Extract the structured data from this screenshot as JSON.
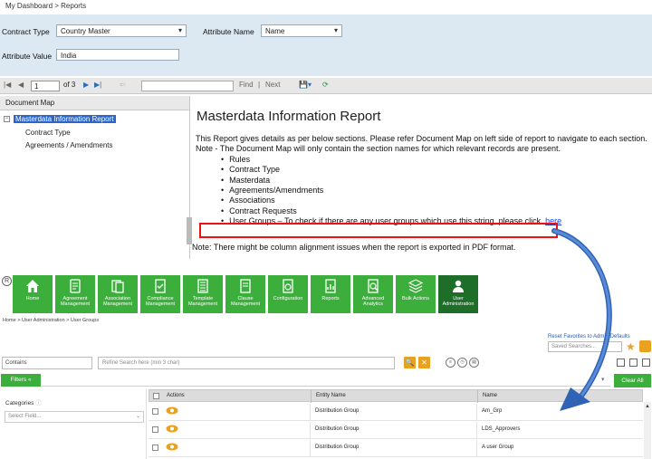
{
  "breadcrumb_top": "My Dashboard > Reports",
  "params": {
    "contract_type_label": "Contract Type",
    "contract_type_value": "Country Master",
    "attribute_name_label": "Attribute Name",
    "attribute_name_value": "Name",
    "attribute_value_label": "Attribute Value",
    "attribute_value_value": "India"
  },
  "toolbar": {
    "page": "1",
    "of_pages": "of 3",
    "find": "Find",
    "separator": "|",
    "next": "Next"
  },
  "docmap": {
    "header": "Document Map",
    "root": "Masterdata Information Report",
    "children": [
      "Contract Type",
      "Agreements / Amendments"
    ]
  },
  "report": {
    "title": "Masterdata Information Report",
    "intro": "This Report gives details as per below sections. Please refer Document Map on left side of report to navigate to each section.",
    "note1": "Note - The Document Map will only contain the section names for which relevant records are present.",
    "bullets": [
      "Rules",
      "Contract Type",
      "Masterdata",
      "Agreements/Amendments",
      "Associations",
      "Contract Requests"
    ],
    "user_groups_text": "User Groups – To check if there are any user groups which use this string, please click",
    "here": "here",
    "note2": "Note: There might be column alignment issues when the report is exported in PDF format."
  },
  "copyright_symbol": "R",
  "modules": [
    {
      "label": "Home",
      "icon": "home-icon"
    },
    {
      "label": "Agreement Management",
      "icon": "agreement-icon"
    },
    {
      "label": "Association Management",
      "icon": "association-icon"
    },
    {
      "label": "Compliance Management",
      "icon": "compliance-icon"
    },
    {
      "label": "Template Management",
      "icon": "template-icon"
    },
    {
      "label": "Clause Management",
      "icon": "clause-icon"
    },
    {
      "label": "Configuration",
      "icon": "configuration-icon"
    },
    {
      "label": "Reports",
      "icon": "reports-icon"
    },
    {
      "label": "Advanced Analytics",
      "icon": "analytics-icon"
    },
    {
      "label": "Bulk Actions",
      "icon": "bulk-actions-icon"
    },
    {
      "label": "User Administration",
      "icon": "user-admin-icon"
    }
  ],
  "breadcrumb_low": "Home > User Administration > User Groups",
  "saved": {
    "reset_link": "Reset Favorites to Admin Defaults",
    "placeholder": "Saved Searches..."
  },
  "search": {
    "contains": "Contains",
    "placeholder": "Refine Search here (min 3 char)",
    "search_btn": "🔍",
    "clear_btn": "✕"
  },
  "filters": {
    "filters_btn": "Filters «",
    "clear_all": "Clear All",
    "categories_label": "Categories",
    "select_field_placeholder": "Select Field..."
  },
  "grid": {
    "headers": [
      "Actions",
      "Entity Name",
      "Name"
    ],
    "rows": [
      {
        "entity": "Distribution Group",
        "name": "Am_Grp"
      },
      {
        "entity": "Distribution Group",
        "name": "LDS_Approvers"
      },
      {
        "entity": "Distribution Group",
        "name": "A user Group"
      }
    ]
  },
  "colors": {
    "module_green": "#3cae3c",
    "module_active": "#1e6e2a",
    "param_bg": "#dce8f2",
    "highlight": "#e11111",
    "accent_orange": "#e8a21f",
    "arrow_blue": "#2f63b5"
  }
}
